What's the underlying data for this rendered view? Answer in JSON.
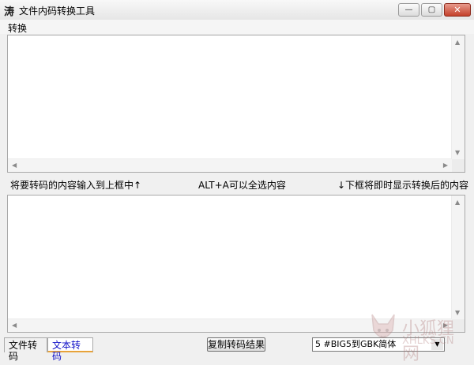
{
  "window": {
    "icon_glyph": "涛",
    "title": "文件内码转换工具",
    "min_glyph": "—",
    "max_glyph": "▢",
    "close_glyph": "✕"
  },
  "menu": {
    "items": [
      {
        "label": "转换"
      }
    ]
  },
  "input_area": {
    "value": ""
  },
  "output_area": {
    "value": ""
  },
  "hints": {
    "left": "将要转码的内容输入到上框中↑",
    "middle": "ALT+A可以全选内容",
    "right": "↓下框将即时显示转换后的内容"
  },
  "tabs": [
    {
      "label": "文件转码",
      "selected": false
    },
    {
      "label": "文本转码",
      "selected": true
    }
  ],
  "copy_button": {
    "label": "复制转码结果"
  },
  "encoding_select": {
    "value": "5 #BIG5到GBK简体"
  },
  "watermark": {
    "text1": "小狐狸网",
    "text2": "XHLKS.CN"
  },
  "icons": [
    "app-icon",
    "minimize-icon",
    "maximize-icon",
    "close-icon",
    "scroll-up-icon",
    "scroll-down-icon",
    "scroll-left-icon",
    "scroll-right-icon",
    "dropdown-arrow-icon",
    "fox-logo-icon"
  ],
  "colors": {
    "tab_text_selected": "#1010c8",
    "tab_underline": "#e8a33a",
    "close_button": "#c4402a"
  }
}
